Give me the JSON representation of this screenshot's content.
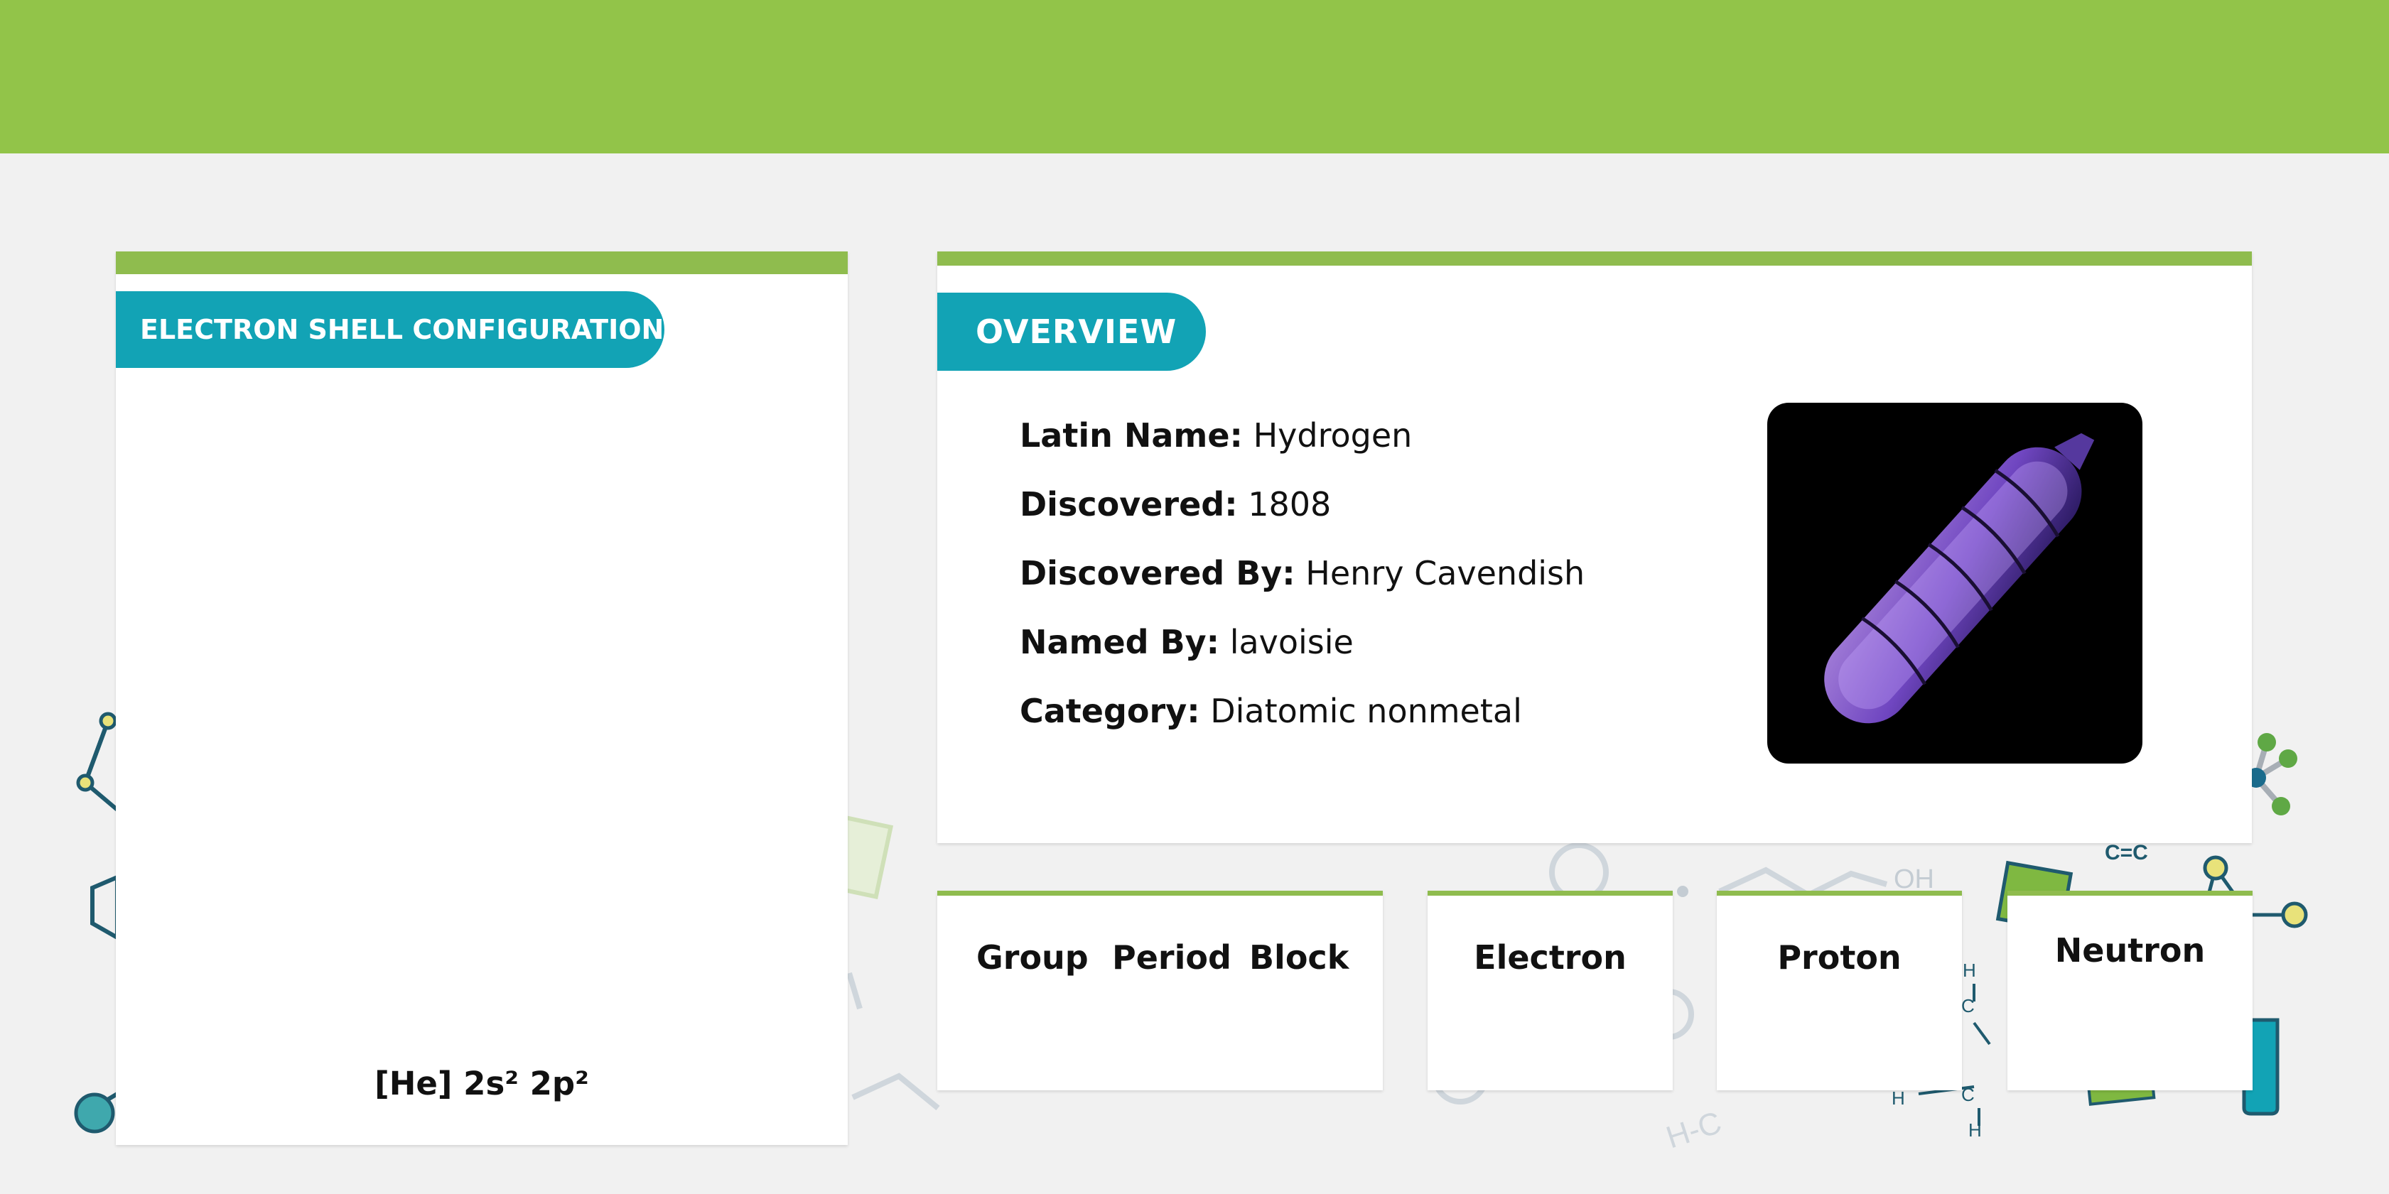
{
  "electron_panel": {
    "title": "ELECTRON SHELL CONFIGURATION",
    "configuration": "[He] 2s² 2p²"
  },
  "overview": {
    "title": "OVERVIEW",
    "fields": [
      {
        "label": "Latin Name:",
        "value": "Hydrogen"
      },
      {
        "label": "Discovered:",
        "value": "1808"
      },
      {
        "label": "Discovered By:",
        "value": "Henry Cavendish"
      },
      {
        "label": "Named By:",
        "value": "lavoisie"
      },
      {
        "label": "Category:",
        "value": "Diatomic nonmetal"
      }
    ]
  },
  "periodic": {
    "group_label": "Group",
    "period_label": "Period",
    "block_label": "Block"
  },
  "particles": {
    "electron_label": "Electron",
    "proton_label": "Proton",
    "neutron_label": "Neutron"
  },
  "background_deco": {
    "labels": [
      "OH",
      "C=C",
      "H-C",
      "H",
      "H",
      "H",
      "C",
      "C"
    ]
  },
  "colors": {
    "brand_green": "#92c449",
    "card_border_green": "#8fbc4e",
    "accent_teal": "#12a3b5",
    "page_background": "#f1f1f1"
  }
}
